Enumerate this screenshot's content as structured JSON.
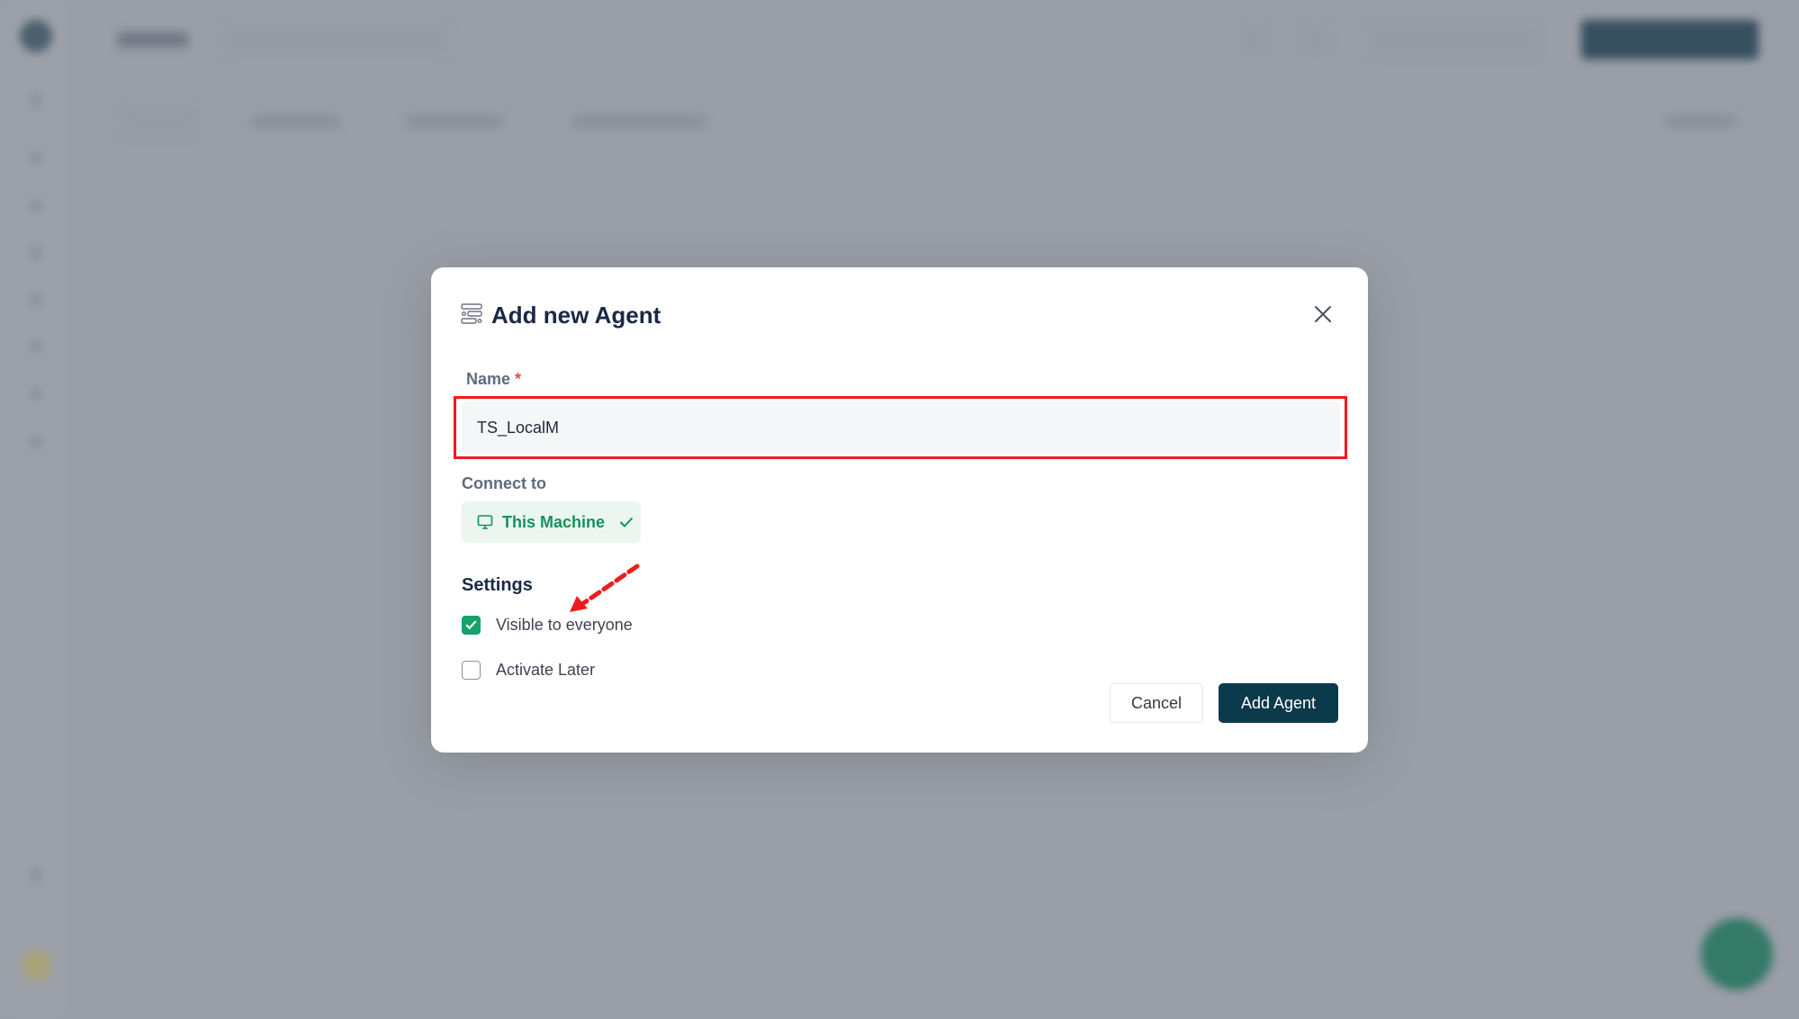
{
  "modal": {
    "title": "Add new Agent",
    "name_label": "Name",
    "required_mark": "*",
    "name_value": "TS_LocalM",
    "connect_label": "Connect to",
    "connect_option": "This Machine",
    "settings_heading": "Settings",
    "checkboxes": [
      {
        "label": "Visible to everyone",
        "checked": true
      },
      {
        "label": "Activate Later",
        "checked": false
      }
    ],
    "cancel_label": "Cancel",
    "submit_label": "Add Agent"
  },
  "colors": {
    "primary": "#0b3a4b",
    "success": "#16a06a",
    "highlight": "#f01b1b",
    "overlay": "#9a9ea7"
  },
  "icons": [
    "agent-list-icon",
    "close-icon",
    "monitor-icon",
    "check-icon",
    "annotation-arrow"
  ]
}
